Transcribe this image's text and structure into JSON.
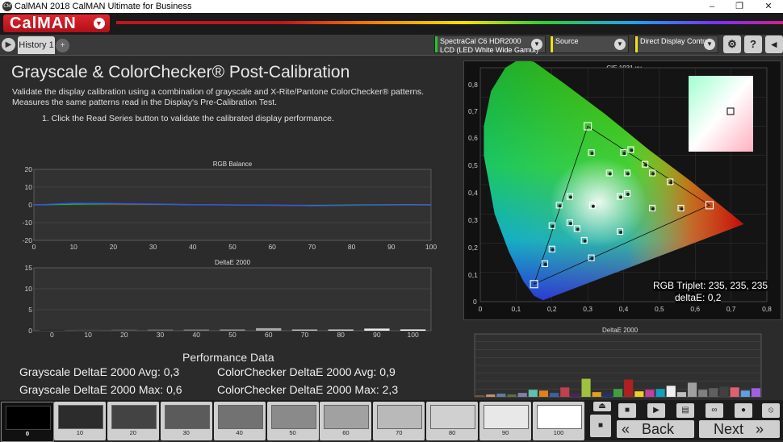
{
  "window": {
    "title": "CalMAN 2018 CalMAN Ultimate for Business",
    "logo": "CM",
    "controls": [
      "–",
      "❐",
      "✕"
    ]
  },
  "brand": {
    "name": "CalMAN"
  },
  "tabs": {
    "history": "History 1",
    "add": "+"
  },
  "toolbar": {
    "meter_line1": "SpectraCal C6 HDR2000",
    "meter_line2": "LCD (LED White Wide Gamut)",
    "source": "Source",
    "display_control": "Direct Display Control",
    "colors": {
      "meter": "#29c12f",
      "source": "#f0e020",
      "display": "#f0e020"
    }
  },
  "page": {
    "title": "Grayscale & ColorChecker® Post-Calibration",
    "desc1": "Validate the display calibration using a combination of grayscale and X-Rite/Pantone ColorChecker® patterns.",
    "desc2": "Measures the same patterns read in the Display's Pre-Calibration Test.",
    "step": "1.  Click the Read Series button to validate the calibrated display performance."
  },
  "rgb_chart": {
    "title": "RGB Balance",
    "yticks": [
      "20",
      "10",
      "0",
      "-10",
      "-20"
    ],
    "xticks": [
      "0",
      "10",
      "20",
      "30",
      "40",
      "50",
      "60",
      "70",
      "80",
      "90",
      "100"
    ]
  },
  "de_chart": {
    "title": "DeltaE 2000",
    "yticks": [
      "15",
      "10",
      "5",
      "0"
    ],
    "xticks": [
      "0",
      "10",
      "20",
      "30",
      "40",
      "50",
      "60",
      "70",
      "80",
      "90",
      "100"
    ]
  },
  "performance": {
    "title": "Performance Data",
    "gs_avg": "Grayscale DeltaE 2000 Avg:  0,3",
    "gs_max": "Grayscale DeltaE 2000 Max: 0,6",
    "cc_avg": "ColorChecker DeltaE 2000 Avg:  0,9",
    "cc_max": "ColorChecker DeltaE 2000 Max: 2,3"
  },
  "cie": {
    "title": "CIE 1931 xy",
    "yticks": [
      "0,8",
      "0,7",
      "0,6",
      "0,5",
      "0,4",
      "0,3",
      "0,2",
      "0,1",
      "0"
    ],
    "xticks": [
      "0",
      "0,1",
      "0,2",
      "0,3",
      "0,4",
      "0,5",
      "0,6",
      "0,7",
      "0,8"
    ],
    "triplet": "RGB Triplet: 235, 235, 235",
    "deltae": "deltaE: 0,2"
  },
  "cc_chart": {
    "title": "DeltaE 2000"
  },
  "swatches": [
    "0",
    "10",
    "20",
    "30",
    "40",
    "50",
    "60",
    "70",
    "80",
    "90",
    "100"
  ],
  "nav": {
    "back": "Back",
    "next": "Next"
  },
  "chart_data": [
    {
      "type": "line",
      "title": "RGB Balance",
      "x": [
        0,
        10,
        20,
        30,
        40,
        50,
        60,
        70,
        80,
        90,
        100
      ],
      "ylim": [
        -20,
        20
      ],
      "series": [
        {
          "values": [
            0,
            0.6,
            0.5,
            0.3,
            0.2,
            0,
            -0.3,
            -0.4,
            -0.2,
            0,
            0.1
          ],
          "color": "#e03030"
        },
        {
          "values": [
            0,
            0.4,
            0.6,
            0.4,
            0.1,
            -0.1,
            -0.2,
            -0.3,
            -0.1,
            0.1,
            0
          ],
          "color": "#20c020"
        },
        {
          "values": [
            0,
            0.9,
            0.8,
            0.5,
            0.2,
            0,
            -0.2,
            -0.5,
            -0.3,
            -0.1,
            -0.1
          ],
          "color": "#3050ff"
        }
      ]
    },
    {
      "type": "bar",
      "title": "DeltaE 2000",
      "categories": [
        "0",
        "10",
        "20",
        "30",
        "40",
        "50",
        "60",
        "70",
        "80",
        "90",
        "100"
      ],
      "values": [
        0.1,
        0.2,
        0.2,
        0.2,
        0.2,
        0.3,
        0.6,
        0.2,
        0.2,
        0.5,
        0.3
      ],
      "ylim": [
        0,
        15
      ]
    },
    {
      "type": "bar",
      "title": "DeltaE 2000",
      "values": [
        0.2,
        0.3,
        0.4,
        0.3,
        0.5,
        0.9,
        0.8,
        0.5,
        1.2,
        0.4,
        2.3,
        0.6,
        0.4,
        1.0,
        2.2,
        0.7,
        0.9,
        1.0,
        1.4,
        0.6,
        1.8,
        0.9,
        1.1,
        1.3,
        1.2,
        0.8,
        1.1
      ]
    },
    {
      "type": "scatter",
      "title": "CIE 1931 xy",
      "xlim": [
        0,
        0.8
      ],
      "ylim": [
        0,
        0.8
      ],
      "points": [
        {
          "x": 0.64,
          "y": 0.33
        },
        {
          "x": 0.3,
          "y": 0.6
        },
        {
          "x": 0.15,
          "y": 0.06
        },
        {
          "x": 0.313,
          "y": 0.329
        },
        {
          "x": 0.48,
          "y": 0.32
        },
        {
          "x": 0.56,
          "y": 0.32
        },
        {
          "x": 0.22,
          "y": 0.33
        },
        {
          "x": 0.2,
          "y": 0.26
        },
        {
          "x": 0.25,
          "y": 0.27
        },
        {
          "x": 0.27,
          "y": 0.25
        },
        {
          "x": 0.29,
          "y": 0.21
        },
        {
          "x": 0.31,
          "y": 0.15
        },
        {
          "x": 0.39,
          "y": 0.24
        },
        {
          "x": 0.18,
          "y": 0.13
        },
        {
          "x": 0.2,
          "y": 0.18
        },
        {
          "x": 0.4,
          "y": 0.51
        },
        {
          "x": 0.42,
          "y": 0.52
        },
        {
          "x": 0.46,
          "y": 0.47
        },
        {
          "x": 0.48,
          "y": 0.44
        },
        {
          "x": 0.53,
          "y": 0.41
        },
        {
          "x": 0.31,
          "y": 0.51
        },
        {
          "x": 0.36,
          "y": 0.44
        },
        {
          "x": 0.41,
          "y": 0.44
        },
        {
          "x": 0.39,
          "y": 0.36
        },
        {
          "x": 0.41,
          "y": 0.37
        },
        {
          "x": 0.25,
          "y": 0.36
        }
      ]
    }
  ]
}
